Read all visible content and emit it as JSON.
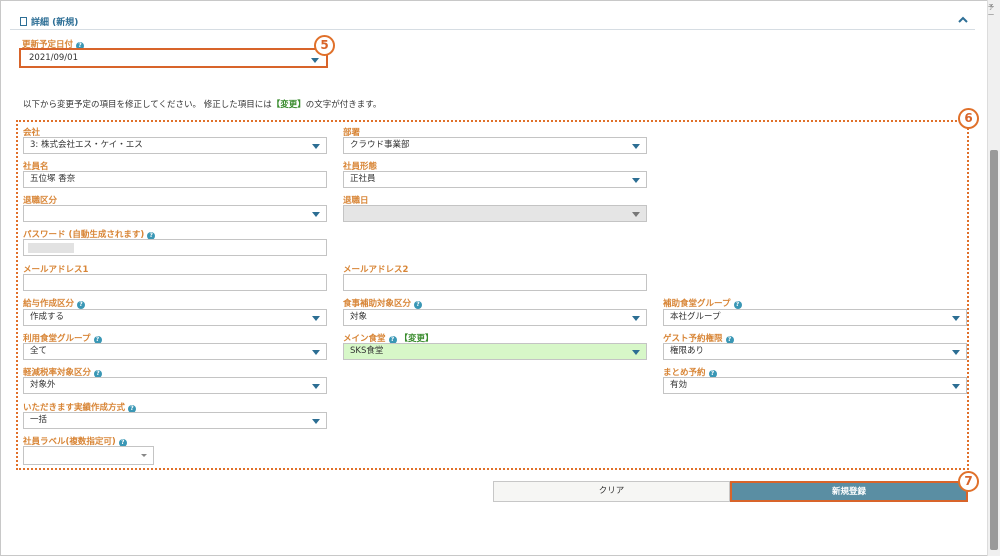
{
  "panel": {
    "title": "詳細 (新規)"
  },
  "scroll_side_text": "予\n一",
  "update_date": {
    "label": "更新予定日付",
    "value": "2021/09/01"
  },
  "badges": {
    "five": "5",
    "six": "6",
    "seven": "7"
  },
  "instruction": {
    "before": "以下から変更予定の項目を修正してください。 修正した項目には",
    "tag": "【変更】",
    "after": "の文字が付きます。"
  },
  "changed_tag": "【変更】",
  "fields": {
    "company": {
      "label": "会社",
      "value": "3: 株式会社エス・ケイ・エス"
    },
    "department": {
      "label": "部署",
      "value": "クラウド事業部"
    },
    "employee_name": {
      "label": "社員名",
      "value": "五位塚 香奈"
    },
    "employment_type": {
      "label": "社員形態",
      "value": "正社員"
    },
    "retirement_type": {
      "label": "退職区分",
      "value": ""
    },
    "retirement_date": {
      "label": "退職日",
      "value": ""
    },
    "password": {
      "label": "パスワード (自動生成されます)",
      "value": ""
    },
    "email1": {
      "label": "メールアドレス1",
      "value": ""
    },
    "email2": {
      "label": "メールアドレス2",
      "value": ""
    },
    "payroll_type": {
      "label": "給与作成区分",
      "value": "作成する"
    },
    "meal_subsidy_target": {
      "label": "食事補助対象区分",
      "value": "対象"
    },
    "subsidy_cafeteria_group": {
      "label": "補助食堂グループ",
      "value": "本社グループ"
    },
    "cafeteria_group": {
      "label": "利用食堂グループ",
      "value": "全て"
    },
    "main_cafeteria": {
      "label": "メイン食堂",
      "value": "SKS食堂"
    },
    "guest_reservation": {
      "label": "ゲスト予約権限",
      "value": "権限あり"
    },
    "reduced_tax_target": {
      "label": "軽減税率対象区分",
      "value": "対象外"
    },
    "bulk_reservation": {
      "label": "まとめ予約",
      "value": "有効"
    },
    "itadakimasu_method": {
      "label": "いただきます実績作成方式",
      "value": "一括"
    },
    "employee_label": {
      "label": "社員ラベル(複数指定可)",
      "value": ""
    }
  },
  "buttons": {
    "clear": "クリア",
    "register": "新規登録"
  },
  "colors": {
    "accent_orange": "#d8642a",
    "label_orange": "#d88536",
    "brand_blue": "#2e6f96",
    "register_bg": "#5a8ea3",
    "changed_bg": "#d7f7c8"
  }
}
